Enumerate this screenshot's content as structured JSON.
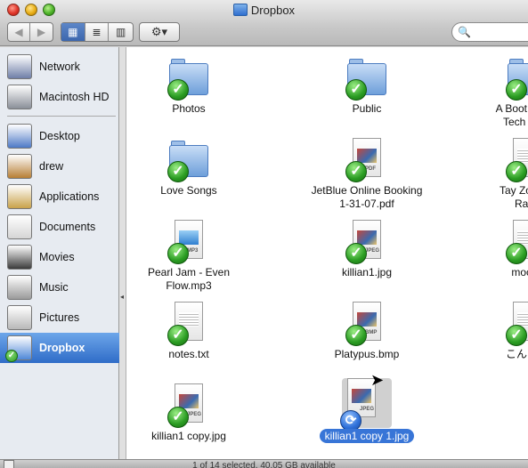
{
  "window": {
    "title": "Dropbox"
  },
  "toolbar": {
    "nav_back": "◀",
    "nav_forward": "▶",
    "view_icon": "▦",
    "view_list": "≣",
    "view_column": "▥",
    "action_label": "⚙▾",
    "search_icon": "🔍"
  },
  "sidebar": {
    "items": [
      {
        "label": "Network",
        "icon": "network-icon"
      },
      {
        "label": "Macintosh HD",
        "icon": "hard-drive-icon"
      },
      {
        "label": "Desktop",
        "icon": "desktop-icon"
      },
      {
        "label": "drew",
        "icon": "home-icon"
      },
      {
        "label": "Applications",
        "icon": "applications-icon"
      },
      {
        "label": "Documents",
        "icon": "documents-icon"
      },
      {
        "label": "Movies",
        "icon": "movies-icon"
      },
      {
        "label": "Music",
        "icon": "music-icon"
      },
      {
        "label": "Pictures",
        "icon": "pictures-icon"
      },
      {
        "label": "Dropbox",
        "icon": "dropbox-icon",
        "selected": true
      }
    ]
  },
  "files": [
    {
      "name": "Photos",
      "kind": "folder"
    },
    {
      "name": "Public",
      "kind": "folder"
    },
    {
      "name": "A Boot Camp\nTech Billio",
      "kind": "folder"
    },
    {
      "name": "Love Songs",
      "kind": "folder"
    },
    {
      "name": "JetBlue Online Booking\n1-31-07.pdf",
      "kind": "doc",
      "type": "PDF"
    },
    {
      "name": "Tay Zonday\nRain.",
      "kind": "doc",
      "type": ""
    },
    {
      "name": "Pearl Jam - Even Flow.mp3",
      "kind": "doc",
      "type": "MP3"
    },
    {
      "name": "killian1.jpg",
      "kind": "doc",
      "type": "JPEG"
    },
    {
      "name": "mocku",
      "kind": "doc",
      "type": ""
    },
    {
      "name": "notes.txt",
      "kind": "doc",
      "type": ""
    },
    {
      "name": "Platypus.bmp",
      "kind": "doc",
      "type": "BMP"
    },
    {
      "name": "こんにち",
      "kind": "doc",
      "type": ""
    },
    {
      "name": "killian1 copy.jpg",
      "kind": "doc",
      "type": "JPEG"
    },
    {
      "name": "killian1 copy 1.jpg",
      "kind": "doc",
      "type": "JPEG",
      "selected": true,
      "syncing": true
    }
  ],
  "status": {
    "text": "1 of 14 selected, 40.05 GB available"
  },
  "colors": {
    "selection": "#3875d7",
    "sync_ok": "#2a9c22",
    "sync_busy": "#2d6fd8"
  }
}
